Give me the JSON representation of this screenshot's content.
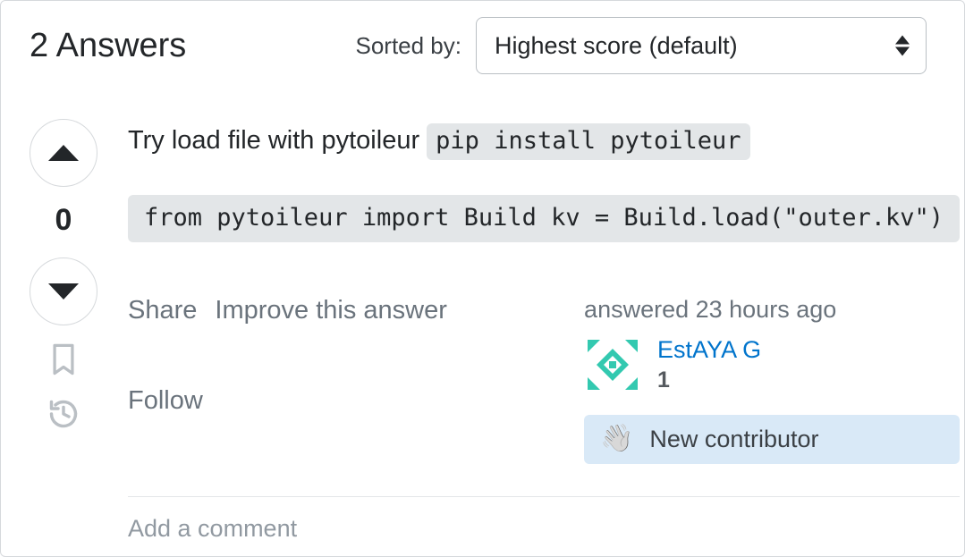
{
  "header": {
    "title": "2 Answers",
    "sort_label": "Sorted by:",
    "sort_value": "Highest score (default)"
  },
  "vote": {
    "score": "0"
  },
  "answer": {
    "prose_prefix": "Try load file with pytoileur ",
    "inline_code": "pip install pytoileur",
    "code_block": "from pytoileur import Build kv = Build.load(\"outer.kv\")"
  },
  "actions": {
    "share": "Share",
    "improve": "Improve this answer",
    "follow": "Follow"
  },
  "usercard": {
    "answered": "answered 23 hours ago",
    "name": "EstAYA G",
    "rep": "1",
    "new_contributor": "New contributor"
  },
  "comments": {
    "add": "Add a comment"
  }
}
